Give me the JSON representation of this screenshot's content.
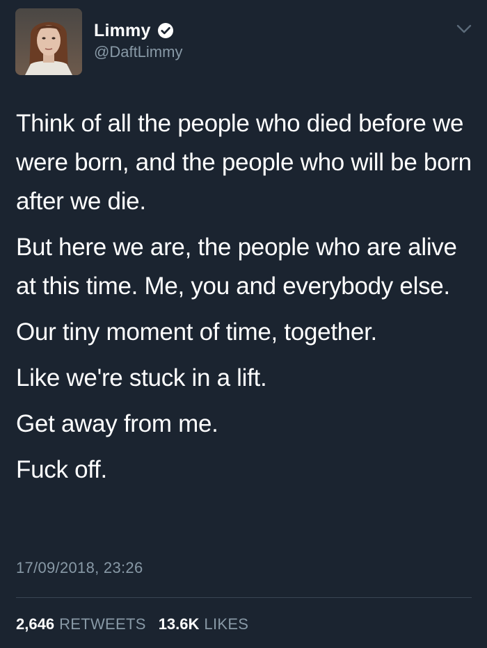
{
  "author": {
    "display_name": "Limmy",
    "handle": "@DaftLimmy",
    "verified": true,
    "avatar_icon": "profile-photo"
  },
  "tweet": {
    "paragraphs": [
      "Think of all the people who died before we were born, and the people who will be born after we die.",
      "But here we are, the people who are alive at this time. Me, you and everybody else.",
      "Our tiny moment of time, together.",
      "Like we're stuck in a lift.",
      "Get away from me.",
      "Fuck off."
    ],
    "timestamp": "17/09/2018, 23:26"
  },
  "stats": {
    "retweets_count": "2,646",
    "retweets_label": "RETWEETS",
    "likes_count": "13.6K",
    "likes_label": "LIKES"
  },
  "colors": {
    "background": "#1b2430",
    "text_primary": "#ffffff",
    "text_secondary": "#8899a6",
    "divider": "#3a4654"
  }
}
